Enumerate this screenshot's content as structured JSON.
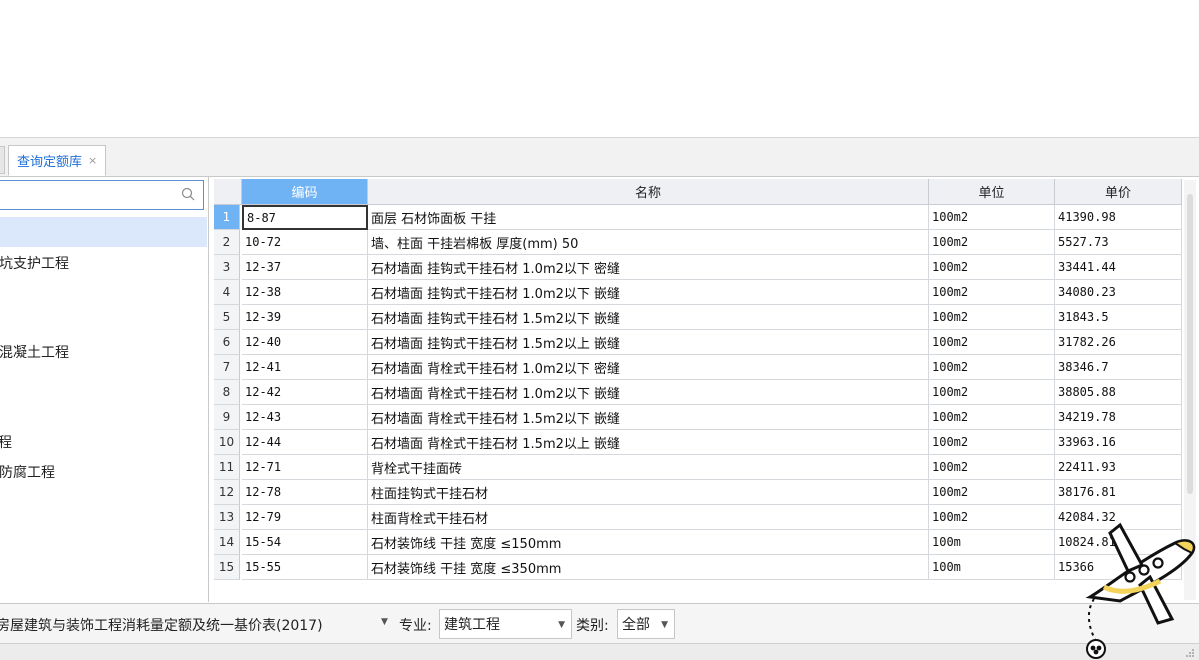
{
  "tab": {
    "label": "查询定额库",
    "close": "×"
  },
  "tree": {
    "items": [
      "坑支护工程",
      "混凝土工程",
      "程",
      "防腐工程"
    ]
  },
  "table": {
    "headers": [
      "编码",
      "名称",
      "单位",
      "单价"
    ],
    "rows": [
      {
        "n": "1",
        "code": "8-87",
        "name": "面层 石材饰面板 干挂",
        "unit": "100m2",
        "price": "41390.98"
      },
      {
        "n": "2",
        "code": "10-72",
        "name": "墙、柱面 干挂岩棉板 厚度(mm) 50",
        "unit": "100m2",
        "price": "5527.73"
      },
      {
        "n": "3",
        "code": "12-37",
        "name": "石材墙面 挂钩式干挂石材 1.0m2以下 密缝",
        "unit": "100m2",
        "price": "33441.44"
      },
      {
        "n": "4",
        "code": "12-38",
        "name": "石材墙面 挂钩式干挂石材 1.0m2以下 嵌缝",
        "unit": "100m2",
        "price": "34080.23"
      },
      {
        "n": "5",
        "code": "12-39",
        "name": "石材墙面 挂钩式干挂石材 1.5m2以下 嵌缝",
        "unit": "100m2",
        "price": "31843.5"
      },
      {
        "n": "6",
        "code": "12-40",
        "name": "石材墙面 挂钩式干挂石材 1.5m2以上 嵌缝",
        "unit": "100m2",
        "price": "31782.26"
      },
      {
        "n": "7",
        "code": "12-41",
        "name": "石材墙面 背栓式干挂石材 1.0m2以下 密缝",
        "unit": "100m2",
        "price": "38346.7"
      },
      {
        "n": "8",
        "code": "12-42",
        "name": "石材墙面 背栓式干挂石材 1.0m2以下 嵌缝",
        "unit": "100m2",
        "price": "38805.88"
      },
      {
        "n": "9",
        "code": "12-43",
        "name": "石材墙面 背栓式干挂石材 1.5m2以下 嵌缝",
        "unit": "100m2",
        "price": "34219.78"
      },
      {
        "n": "10",
        "code": "12-44",
        "name": "石材墙面 背栓式干挂石材 1.5m2以上 嵌缝",
        "unit": "100m2",
        "price": "33963.16"
      },
      {
        "n": "11",
        "code": "12-71",
        "name": "背栓式干挂面砖",
        "unit": "100m2",
        "price": "22411.93"
      },
      {
        "n": "12",
        "code": "12-78",
        "name": "柱面挂钩式干挂石材",
        "unit": "100m2",
        "price": "38176.81"
      },
      {
        "n": "13",
        "code": "12-79",
        "name": "柱面背栓式干挂石材",
        "unit": "100m2",
        "price": "42084.32"
      },
      {
        "n": "14",
        "code": "15-54",
        "name": "石材装饰线 干挂 宽度 ≤150mm",
        "unit": "100m",
        "price": "10824.81"
      },
      {
        "n": "15",
        "code": "15-55",
        "name": "石材装饰线 干挂 宽度 ≤350mm",
        "unit": "100m",
        "price": "15366"
      }
    ]
  },
  "statusbar": {
    "library": "房屋建筑与装饰工程消耗量定额及统一基价表(2017)",
    "specialty_label": "专业:",
    "specialty_value": "建筑工程",
    "category_label": "类别:",
    "category_value": "全部"
  },
  "colors": {
    "accent": "#6fb3f5",
    "tab_text": "#1e6fd6",
    "selection": "#dbe8fb"
  }
}
